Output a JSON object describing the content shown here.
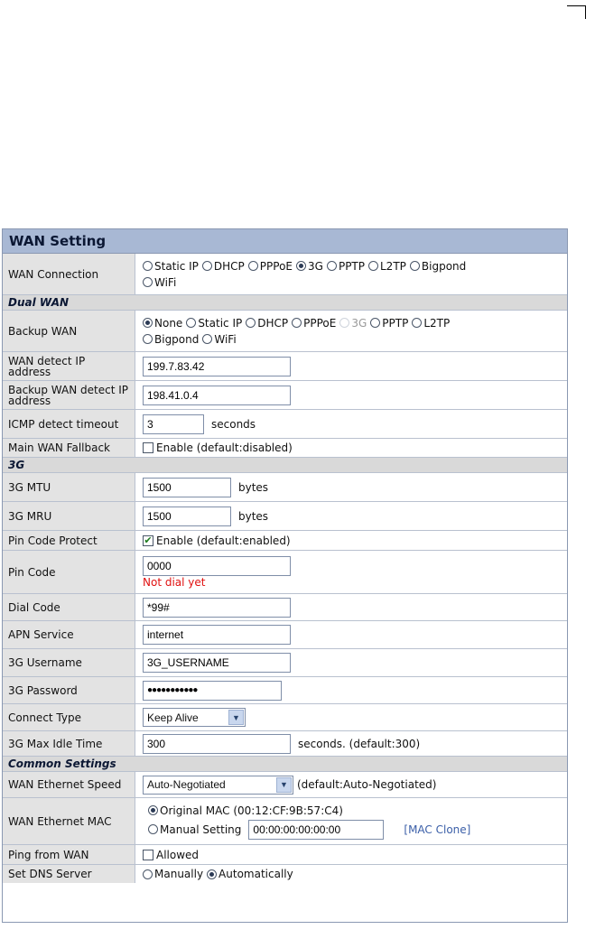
{
  "title": "WAN Setting",
  "wan_connection": {
    "label": "WAN Connection",
    "options": [
      "Static IP",
      "DHCP",
      "PPPoE",
      "3G",
      "PPTP",
      "L2TP",
      "Bigpond",
      "WiFi"
    ],
    "selected": "3G"
  },
  "dual_wan": {
    "section": "Dual WAN",
    "backup_label": "Backup WAN",
    "backup_options": [
      "None",
      "Static IP",
      "DHCP",
      "PPPoE",
      "3G",
      "PPTP",
      "L2TP",
      "Bigpond",
      "WiFi"
    ],
    "backup_selected": "None",
    "backup_disabled": "3G",
    "detect_ip_label": "WAN detect IP address",
    "detect_ip_value": "199.7.83.42",
    "backup_detect_label": "Backup WAN detect IP address",
    "backup_detect_value": "198.41.0.4",
    "icmp_label": "ICMP detect timeout",
    "icmp_value": "3",
    "icmp_unit": "seconds",
    "fallback_label": "Main WAN Fallback",
    "fallback_text": "Enable (default:disabled)",
    "fallback_checked": false
  },
  "g3": {
    "section": "3G",
    "mtu_label": "3G MTU",
    "mtu_value": "1500",
    "mtu_unit": "bytes",
    "mru_label": "3G MRU",
    "mru_value": "1500",
    "mru_unit": "bytes",
    "pin_protect_label": "Pin Code Protect",
    "pin_protect_text": "Enable (default:enabled)",
    "pin_protect_checked": true,
    "pin_label": "Pin Code",
    "pin_value": "0000",
    "pin_status": "Not dial yet",
    "dial_label": "Dial Code",
    "dial_value": "*99#",
    "apn_label": "APN Service",
    "apn_value": "internet",
    "user_label": "3G Username",
    "user_value": "3G_USERNAME",
    "pass_label": "3G Password",
    "pass_value": "●●●●●●●●●●●",
    "connect_label": "Connect Type",
    "connect_value": "Keep Alive",
    "idle_label": "3G Max Idle Time",
    "idle_value": "300",
    "idle_unit": "seconds. (default:300)"
  },
  "common": {
    "section": "Common Settings",
    "speed_label": "WAN Ethernet Speed",
    "speed_value": "Auto-Negotiated",
    "speed_default": "(default:Auto-Negotiated)",
    "mac_label": "WAN Ethernet MAC",
    "mac_original": "Original MAC (00:12:CF:9B:57:C4)",
    "mac_manual": "Manual Setting",
    "mac_value": "00:00:00:00:00:00",
    "mac_clone": "[MAC Clone]",
    "mac_selected": "original",
    "ping_label": "Ping from WAN",
    "ping_text": "Allowed",
    "ping_checked": false,
    "dns_label": "Set DNS Server",
    "dns_manual": "Manually",
    "dns_auto": "Automatically",
    "dns_selected": "auto"
  },
  "icons": {
    "select_arrow": "chevron-down-icon",
    "check": "check-icon"
  },
  "colors": {
    "title_bg": "#a8b8d4",
    "label_bg": "#e3e3e3",
    "section_bg": "#d9d9d9",
    "error": "#e01010",
    "link": "#3b5fa8"
  }
}
